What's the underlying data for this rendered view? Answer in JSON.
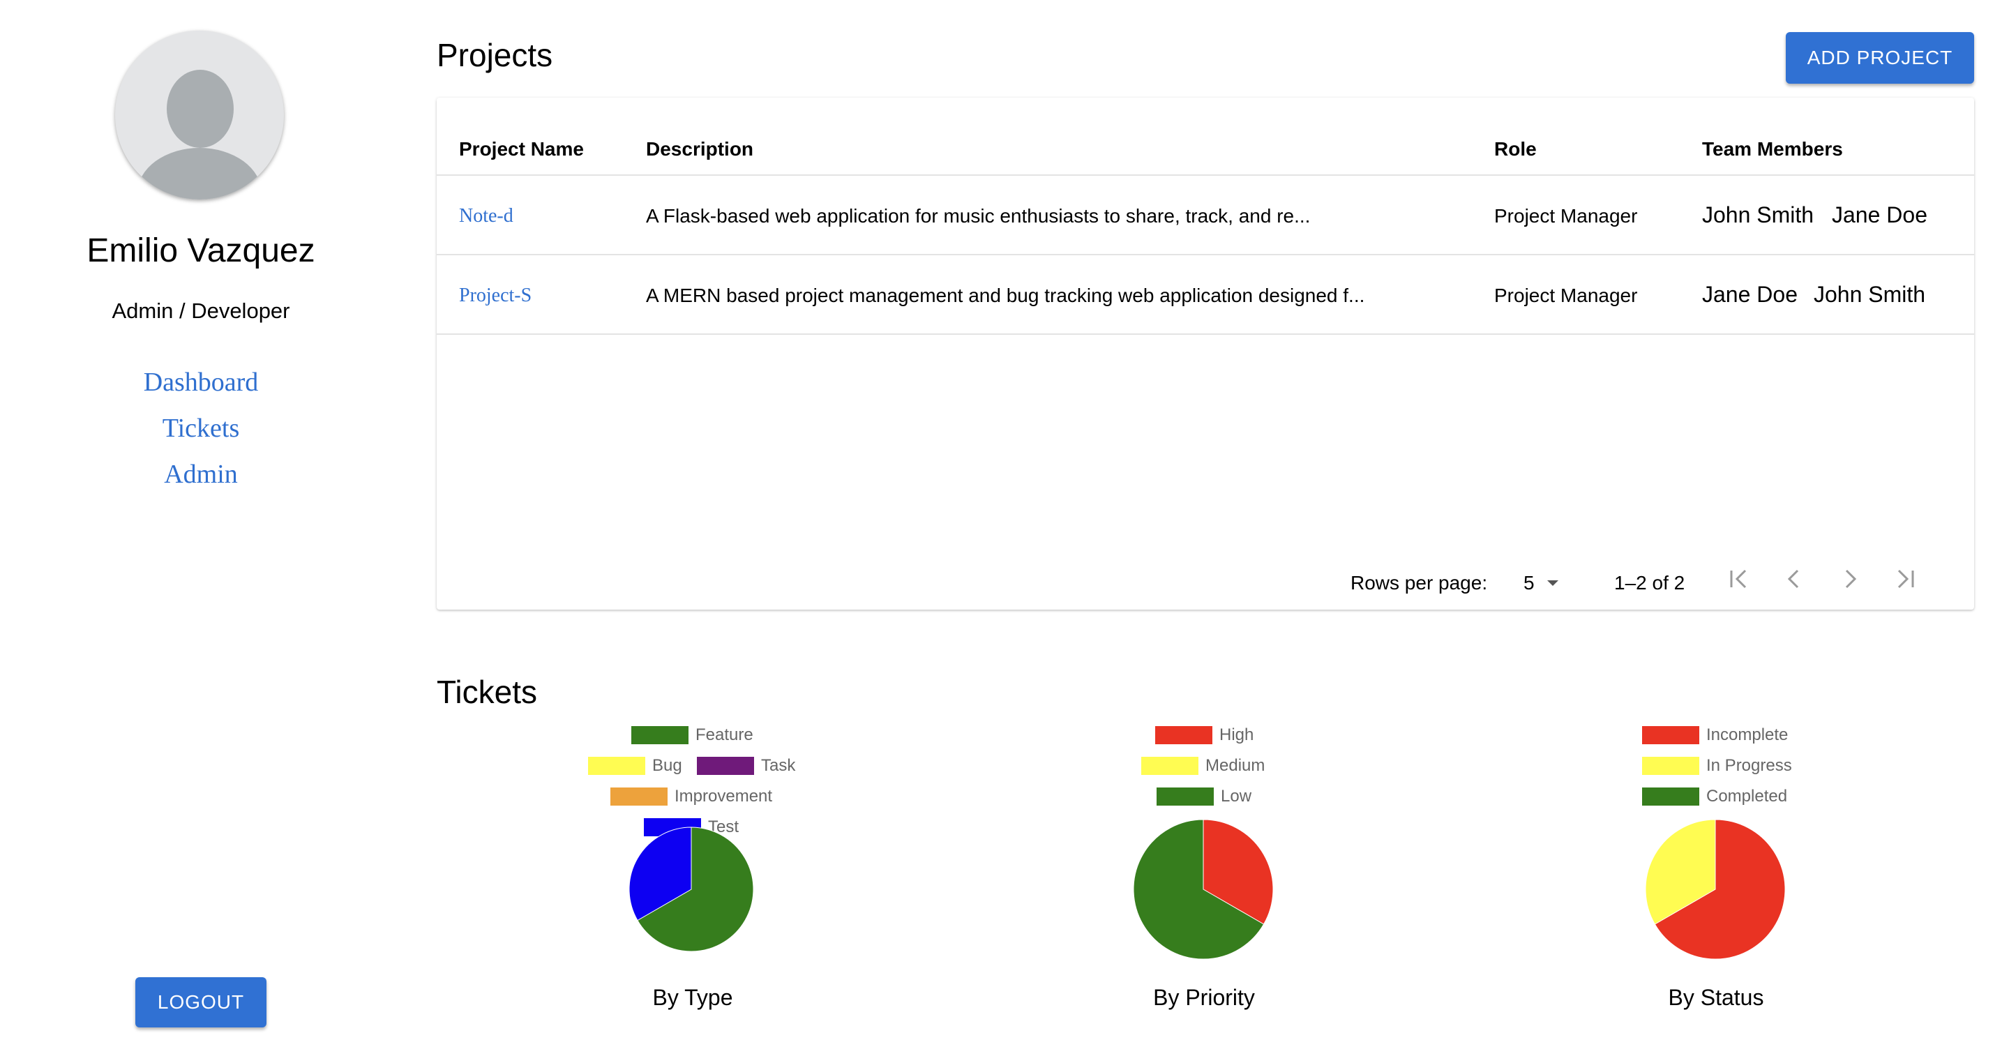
{
  "sidebar": {
    "user_name": "Emilio Vazquez",
    "user_role": "Admin / Developer",
    "nav": [
      {
        "label": "Dashboard"
      },
      {
        "label": "Tickets"
      },
      {
        "label": "Admin"
      }
    ],
    "logout_label": "LOGOUT"
  },
  "projects": {
    "title": "Projects",
    "add_label": "ADD PROJECT",
    "columns": [
      "Project Name",
      "Description",
      "Role",
      "Team Members"
    ],
    "rows": [
      {
        "name": "Note-d",
        "description": "A Flask-based web application for music enthusiasts to share, track, and re...",
        "role": "Project Manager",
        "members": [
          "John Smith",
          "Jane Doe"
        ]
      },
      {
        "name": "Project-S",
        "description": "A MERN based project management and bug tracking web application designed f...",
        "role": "Project Manager",
        "members": [
          "Jane Doe",
          "John Smith"
        ]
      }
    ],
    "pagination": {
      "rows_per_page_label": "Rows per page:",
      "rows_per_page": "5",
      "range": "1–2 of 2"
    }
  },
  "tickets": {
    "title": "Tickets"
  },
  "chart_data": [
    {
      "type": "pie",
      "title": "By Type",
      "categories": [
        "Feature",
        "Bug",
        "Task",
        "Improvement",
        "Test"
      ],
      "values": [
        2,
        0,
        0,
        0,
        1
      ],
      "colors": [
        "#367d1d",
        "#fffc52",
        "#6f1a7a",
        "#eda23c",
        "#0d00f2"
      ]
    },
    {
      "type": "pie",
      "title": "By Priority",
      "categories": [
        "High",
        "Medium",
        "Low"
      ],
      "values": [
        1,
        0,
        2
      ],
      "colors": [
        "#e93323",
        "#fffc52",
        "#367d1d"
      ]
    },
    {
      "type": "pie",
      "title": "By Status",
      "categories": [
        "Incomplete",
        "In Progress",
        "Completed"
      ],
      "values": [
        2,
        1,
        0
      ],
      "colors": [
        "#e93323",
        "#fffc52",
        "#367d1d"
      ]
    }
  ]
}
